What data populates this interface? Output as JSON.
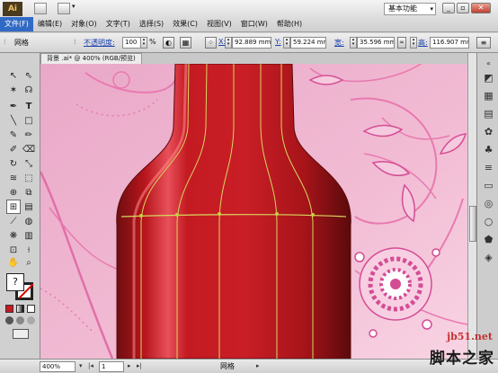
{
  "app": {
    "logo": "Ai",
    "workspace": "基本功能"
  },
  "menu": [
    {
      "label": "文件(F)"
    },
    {
      "label": "编辑(E)"
    },
    {
      "label": "对象(O)"
    },
    {
      "label": "文字(T)"
    },
    {
      "label": "选择(S)"
    },
    {
      "label": "效果(C)"
    },
    {
      "label": "视图(V)"
    },
    {
      "label": "窗口(W)"
    },
    {
      "label": "帮助(H)"
    }
  ],
  "control_bar": {
    "selection_type": "网格",
    "opacity_label": "不透明度:",
    "opacity_value": "100",
    "opacity_unit": "%",
    "x_label": "X:",
    "x_value": "92.889 mm",
    "y_label": "Y:",
    "y_value": "59.224 mm",
    "w_label": "宽:",
    "w_value": "35.596 mm",
    "h_label": "高:",
    "h_value": "116.907 mr"
  },
  "document": {
    "tab_title": "背景 .ai* @ 400% (RGB/预览)"
  },
  "status_bar": {
    "zoom": "400%",
    "artboard": "1",
    "tool_status": "网格"
  },
  "colors": {
    "bottle_red": "#c41a22",
    "background_pink": "#f0b8d2",
    "mesh_line": "#d8d860",
    "selection_accent": "#316ac5"
  },
  "watermark": {
    "url": "jb51.net",
    "site_name": "脚本之家"
  }
}
